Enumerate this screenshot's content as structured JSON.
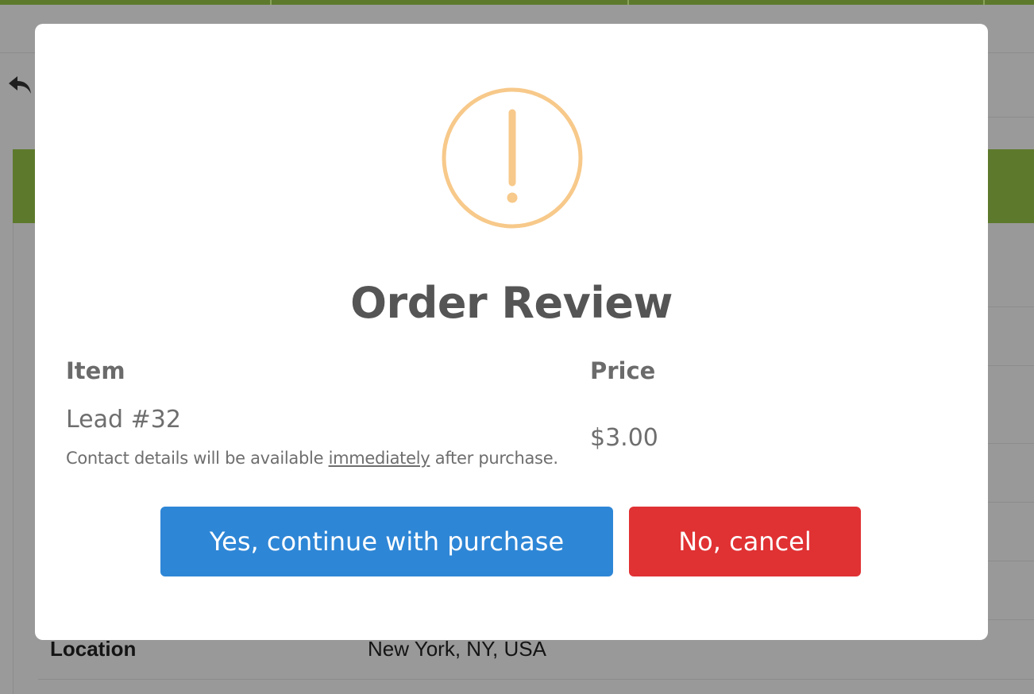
{
  "background": {
    "detail_label": "Location",
    "detail_value": "New York, NY, USA",
    "back_icon": "undo-arrow-icon",
    "accent_color": "#5d7a2c"
  },
  "modal": {
    "icon": "warning-exclamation-icon",
    "icon_color": "#f7c98a",
    "title": "Order Review",
    "headers": {
      "item": "Item",
      "price": "Price"
    },
    "item": {
      "name": "Lead #32",
      "desc_before": "Contact details will be available ",
      "desc_emphasis": "immediately",
      "desc_after": " after purchase.",
      "price": "$3.00"
    },
    "buttons": {
      "confirm": {
        "label": "Yes, continue with purchase",
        "color": "#2e86d6"
      },
      "cancel": {
        "label": "No, cancel",
        "color": "#e03133"
      }
    }
  }
}
